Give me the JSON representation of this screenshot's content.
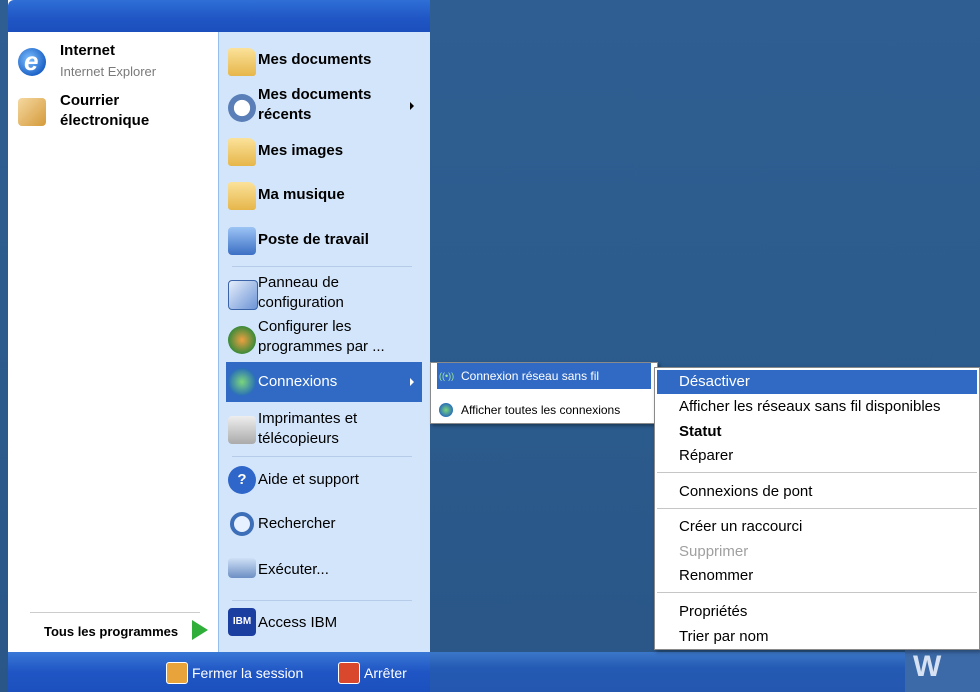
{
  "start_menu": {
    "pinned": [
      {
        "title": "Internet",
        "subtitle": "Internet Explorer"
      },
      {
        "title": "Courrier",
        "title2": "électronique"
      }
    ],
    "all_programs_label": "Tous les programmes",
    "right": {
      "my_documents": "Mes documents",
      "recent_documents_1": "Mes documents",
      "recent_documents_2": "récents",
      "my_pictures": "Mes images",
      "my_music": "Ma musique",
      "my_computer": "Poste de travail",
      "control_panel_1": "Panneau de",
      "control_panel_2": "configuration",
      "set_programs_1": "Configurer les",
      "set_programs_2": "programmes par ...",
      "connections": "Connexions",
      "printers_1": "Imprimantes et",
      "printers_2": "télécopieurs",
      "help": "Aide et support",
      "search": "Rechercher",
      "run": "Exécuter...",
      "access_ibm": "Access IBM"
    },
    "footer": {
      "logoff": "Fermer la session",
      "shutdown": "Arrêter"
    }
  },
  "connections_submenu": {
    "items": [
      "Connexion réseau sans fil",
      "Afficher toutes les connexions"
    ]
  },
  "context_menu": {
    "items": [
      "Désactiver",
      "Afficher les réseaux sans fil disponibles",
      "Statut",
      "Réparer",
      "Connexions de pont",
      "Créer un raccourci",
      "Supprimer",
      "Renommer",
      "Propriétés",
      "Trier par nom"
    ]
  },
  "desktop": {
    "logo_fragment": "W"
  },
  "colors": {
    "highlight": "#316ac5",
    "menu_blue": "#1f55c4",
    "right_pane": "#d3e5fa"
  }
}
